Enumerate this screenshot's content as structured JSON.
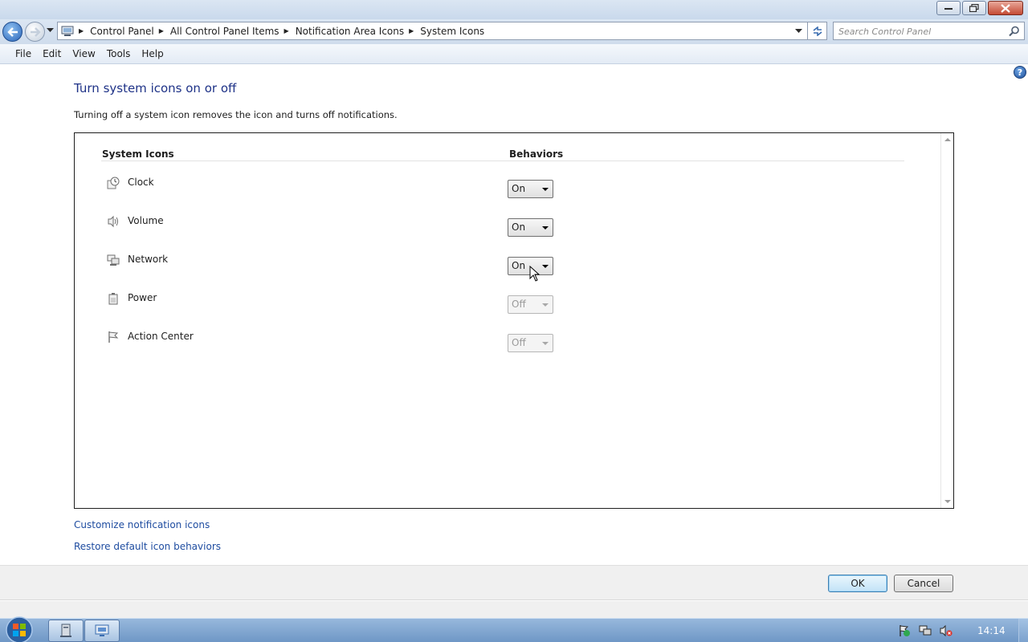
{
  "window": {
    "minimize_icon": "minimize-icon",
    "restore_icon": "restore-icon",
    "close_icon": "close-icon"
  },
  "address_bar": {
    "breadcrumbs": [
      "Control Panel",
      "All Control Panel Items",
      "Notification Area Icons",
      "System Icons"
    ],
    "search_placeholder": "Search Control Panel"
  },
  "menu": {
    "items": [
      {
        "label": "File"
      },
      {
        "label": "Edit"
      },
      {
        "label": "View"
      },
      {
        "label": "Tools"
      },
      {
        "label": "Help"
      }
    ]
  },
  "page": {
    "title": "Turn system icons on or off",
    "description": "Turning off a system icon removes the icon and turns off notifications."
  },
  "table": {
    "col_system_icons": "System Icons",
    "col_behaviors": "Behaviors",
    "rows": [
      {
        "name": "Clock",
        "icon": "clock-icon",
        "behavior": "On",
        "enabled": true
      },
      {
        "name": "Volume",
        "icon": "volume-icon",
        "behavior": "On",
        "enabled": true
      },
      {
        "name": "Network",
        "icon": "network-icon",
        "behavior": "On",
        "enabled": true
      },
      {
        "name": "Power",
        "icon": "power-icon",
        "behavior": "Off",
        "enabled": false
      },
      {
        "name": "Action Center",
        "icon": "flag-icon",
        "behavior": "Off",
        "enabled": false
      }
    ]
  },
  "links": {
    "customize": "Customize notification icons",
    "restore": "Restore default icon behaviors"
  },
  "buttons": {
    "ok": "OK",
    "cancel": "Cancel"
  },
  "taskbar": {
    "clock": "14:14"
  },
  "colors": {
    "title_blue": "#1e3287",
    "link_blue": "#1e4ca0",
    "taskbar": "#6f97c6"
  }
}
